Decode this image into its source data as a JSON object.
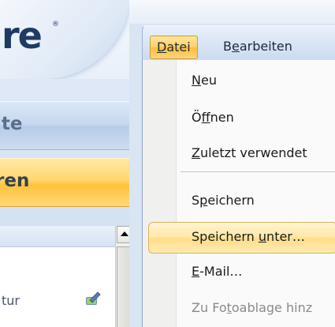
{
  "background_app": {
    "logo_text": "re",
    "logo_mark": "®",
    "nav_tab_1": "ite",
    "nav_tab_2": "ren",
    "list_item_label": "tur",
    "list_item_icon": "pencil-edit-icon",
    "scroll_up_icon": "arrow-up-icon"
  },
  "menubar": {
    "items": [
      {
        "label": "Datei",
        "mnemonic": "D",
        "rest": "atei",
        "active": true
      },
      {
        "label": "Bearbeiten",
        "mnemonic": "e",
        "pre": "B",
        "rest": "arbeiten",
        "active": false
      }
    ]
  },
  "file_menu": {
    "items": [
      {
        "label": "Neu",
        "pre": "",
        "mn": "N",
        "post": "eu",
        "enabled": true
      },
      {
        "label": "Öffnen",
        "pre": "Ö",
        "mn": "f",
        "post": "fnen",
        "enabled": true
      },
      {
        "label": "Zuletzt verwendet",
        "pre": "",
        "mn": "Z",
        "post": "uletzt verwendet",
        "enabled": true
      },
      {
        "label": "Speichern",
        "pre": "S",
        "mn": "p",
        "post": "eichern",
        "enabled": true
      },
      {
        "label": "Speichern unter...",
        "pre": "Speichern ",
        "mn": "u",
        "post": "nter…",
        "enabled": true,
        "highlighted": true
      },
      {
        "label": "E-Mail...",
        "pre": "",
        "mn": "E",
        "post": "-Mail…",
        "enabled": true
      },
      {
        "label": "Zu Fotoablage hinz",
        "pre": "Zu Fo",
        "mn": "t",
        "post": "oablage hinz",
        "enabled": false
      }
    ]
  },
  "colors": {
    "highlight": "#ffdd8a",
    "menubar": "#c9daf0",
    "nav_active": "#ffc33a"
  }
}
